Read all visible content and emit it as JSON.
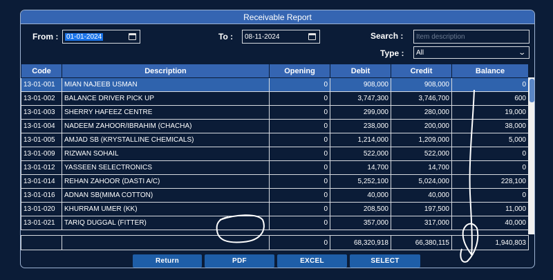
{
  "window": {
    "title": "Receivable Report"
  },
  "filters": {
    "from_label": "From :",
    "from_value": "01-01-2024",
    "to_label": "To :",
    "to_value": "08-11-2024",
    "search_label": "Search :",
    "search_placeholder": "Item description",
    "type_label": "Type :",
    "type_value": "All"
  },
  "table": {
    "columns": [
      "Code",
      "Description",
      "Opening",
      "Debit",
      "Credit",
      "Balance"
    ],
    "rows": [
      [
        "13-01-001",
        "MIAN NAJEEB USMAN",
        "0",
        "908,000",
        "908,000",
        "0"
      ],
      [
        "13-01-002",
        "BALANCE DRIVER PICK UP",
        "0",
        "3,747,300",
        "3,746,700",
        "600"
      ],
      [
        "13-01-003",
        "SHERRY HAFEEZ CENTRE",
        "0",
        "299,000",
        "280,000",
        "19,000"
      ],
      [
        "13-01-004",
        "NADEEM ZAHOOR/IBRAHIM (CHACHA)",
        "0",
        "238,000",
        "200,000",
        "38,000"
      ],
      [
        "13-01-005",
        "AMJAD SB (KRYSTALLINE CHEMICALS)",
        "0",
        "1,214,000",
        "1,209,000",
        "5,000"
      ],
      [
        "13-01-009",
        "RIZWAN SOHAIL",
        "0",
        "522,000",
        "522,000",
        "0"
      ],
      [
        "13-01-012",
        "YASSEEN SELECTRONICS",
        "0",
        "14,700",
        "14,700",
        "0"
      ],
      [
        "13-01-014",
        "REHAN ZAHOOR (DASTI A/C)",
        "0",
        "5,252,100",
        "5,024,000",
        "228,100"
      ],
      [
        "13-01-016",
        "ADNAN SB(MIMA COTTON)",
        "0",
        "40,000",
        "40,000",
        "0"
      ],
      [
        "13-01-020",
        "KHURRAM UMER (KK)",
        "0",
        "208,500",
        "197,500",
        "11,000"
      ],
      [
        "13-01-021",
        "TARIQ DUGGAL (FITTER)",
        "0",
        "357,000",
        "317,000",
        "40,000"
      ]
    ],
    "selected_row_index": 0,
    "totals": {
      "opening": "0",
      "debit": "68,320,918",
      "credit": "66,380,115",
      "balance": "1,940,803"
    }
  },
  "buttons": {
    "return": "Return",
    "pdf": "PDF",
    "excel": "EXCEL",
    "select": "SELECT"
  },
  "colors": {
    "background": "#0b1c37",
    "header": "#3565b2",
    "selected_row": "#2f63ad",
    "button": "#1e5ea8"
  },
  "icons": {
    "date_picker": "calendar-icon",
    "type_dropdown": "chevron-down-icon"
  }
}
